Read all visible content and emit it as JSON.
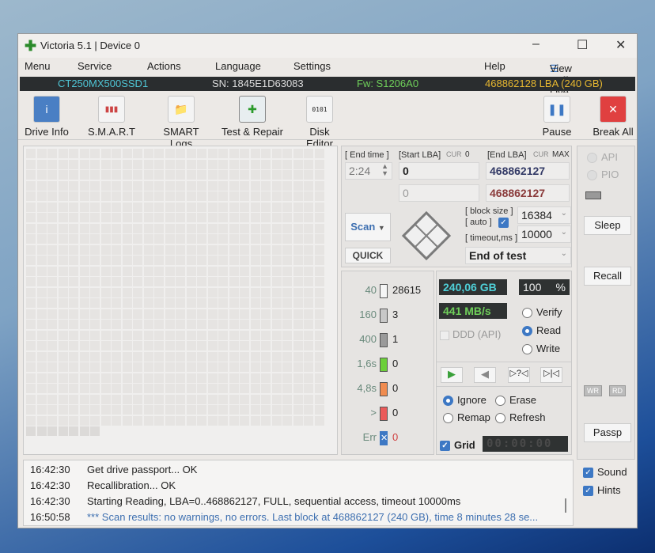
{
  "window": {
    "title": "Victoria 5.1 | Device 0",
    "minimize": "–",
    "maximize": "☐",
    "close": "✕"
  },
  "menu": [
    "Menu",
    "Service",
    "Actions",
    "Language",
    "Settings",
    "Help"
  ],
  "view_buffer": "View Buffer Live",
  "device": {
    "model": "CT250MX500SSD1",
    "serial": "SN: 1845E1D63083",
    "firmware": "Fw: S1206A0",
    "capacity": "468862128 LBA (240 GB)"
  },
  "toolbar": [
    {
      "label": "Drive Info",
      "icon": "i"
    },
    {
      "label": "S.M.A.R.T",
      "icon": "▮▮▮"
    },
    {
      "label": "SMART Logs",
      "icon": "📁"
    },
    {
      "label": "Test & Repair",
      "icon": "✚"
    },
    {
      "label": "Disk Editor",
      "icon": "0101"
    },
    {
      "label": "Pause",
      "icon": "❚❚"
    },
    {
      "label": "Break All",
      "icon": "✕"
    }
  ],
  "scan": {
    "end_time_label": "[ End time ]",
    "end_time": "2:24",
    "start_lba_label": "[Start LBA]",
    "cur": "CUR",
    "cur_value": "0",
    "end_lba_label": "[End LBA]",
    "max": "MAX",
    "start_lba": "0",
    "end_lba": "468862127",
    "start_lba2": "0",
    "end_lba2": "468862127",
    "block_size_label": "[ block size ]",
    "auto_label": "[ auto ]",
    "timeout_label": "[ timeout,ms ]",
    "block_size": "16384",
    "timeout": "10000",
    "scan_button": "Scan",
    "quick_button": "QUICK",
    "end_action": "End of test"
  },
  "legend": [
    {
      "threshold": "40",
      "count": "28615",
      "color": "#f5f5f5"
    },
    {
      "threshold": "160",
      "count": "3",
      "color": "#c8c8c8"
    },
    {
      "threshold": "400",
      "count": "1",
      "color": "#9a9a9a"
    },
    {
      "threshold": "1,6s",
      "count": "0",
      "color": "#6ccf3a"
    },
    {
      "threshold": "4,8s",
      "count": "0",
      "color": "#f08c50"
    },
    {
      "threshold": ">",
      "count": "0",
      "color": "#ea5a5a"
    },
    {
      "threshold": "Err",
      "count": "0",
      "color": "#3d78c4"
    }
  ],
  "stats": {
    "size": "240,06 GB",
    "percent": "100",
    "percent_sign": "%",
    "speed": "441 MB/s",
    "ddd": "DDD (API)"
  },
  "mode": {
    "options": [
      "Verify",
      "Read",
      "Write"
    ],
    "selected": "Read"
  },
  "repair": {
    "options": [
      "Ignore",
      "Erase",
      "Remap",
      "Refresh"
    ],
    "selected": "Ignore"
  },
  "grid": {
    "label": "Grid",
    "timer": "00:00:00"
  },
  "side": {
    "api": "API",
    "pio": "PIO",
    "sleep": "Sleep",
    "recall": "Recall",
    "wr": "WR",
    "rd": "RD",
    "passp": "Passp",
    "sound": "Sound",
    "hints": "Hints"
  },
  "log": [
    {
      "time": "16:42:30",
      "text": "Get drive passport... OK"
    },
    {
      "time": "16:42:30",
      "text": "Recallibration... OK"
    },
    {
      "time": "16:42:30",
      "text": "Starting Reading, LBA=0..468862127, FULL, sequential access, timeout 10000ms"
    },
    {
      "time": "16:50:58",
      "text": "*** Scan results: no warnings, no errors. Last block at 468862127 (240 GB), time 8 minutes 28 se..."
    }
  ]
}
